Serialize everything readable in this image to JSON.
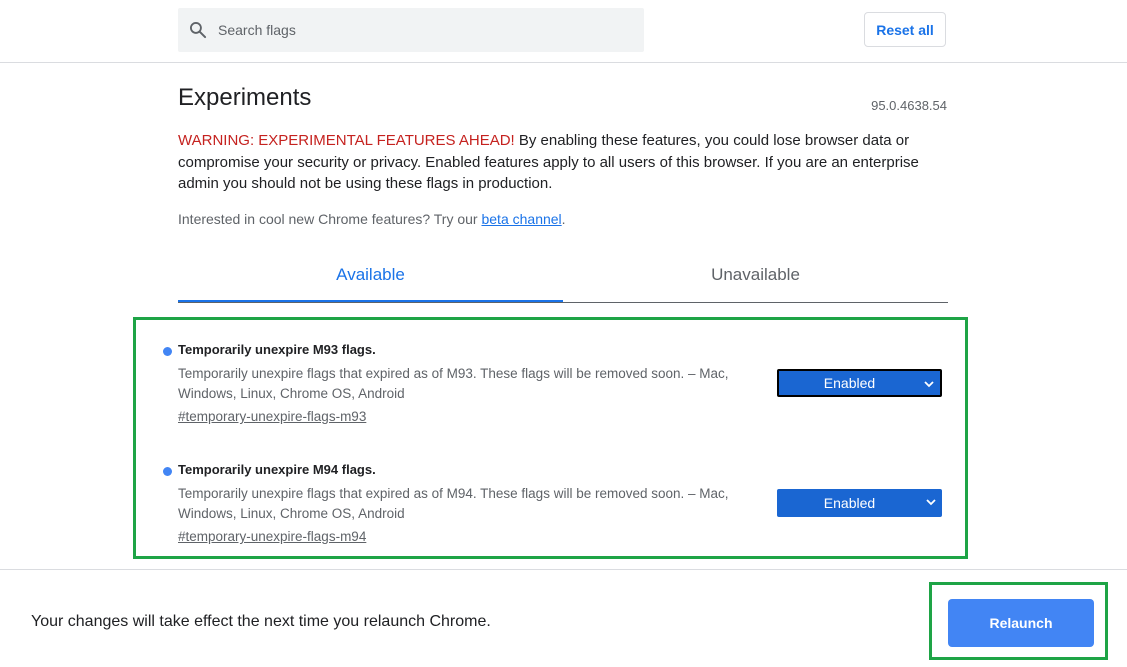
{
  "header": {
    "search_placeholder": "Search flags",
    "search_icon": "search-icon",
    "reset_label": "Reset all"
  },
  "main": {
    "title": "Experiments",
    "version": "95.0.4638.54",
    "warning_prefix": "WARNING: EXPERIMENTAL FEATURES AHEAD!",
    "warning_text": " By enabling these features, you could lose browser data or compromise your security or privacy. Enabled features apply to all users of this browser. If you are an enterprise admin you should not be using these flags in production.",
    "interest_text": "Interested in cool new Chrome features? Try our ",
    "interest_link": "beta channel",
    "interest_suffix": "."
  },
  "tabs": {
    "available": "Available",
    "unavailable": "Unavailable"
  },
  "flags": [
    {
      "title": "Temporarily unexpire M93 flags.",
      "description": "Temporarily unexpire flags that expired as of M93. These flags will be removed soon. – Mac, Windows, Linux, Chrome OS, Android",
      "link": "#temporary-unexpire-flags-m93",
      "value": "Enabled"
    },
    {
      "title": "Temporarily unexpire M94 flags.",
      "description": "Temporarily unexpire flags that expired as of M94. These flags will be removed soon. – Mac, Windows, Linux, Chrome OS, Android",
      "link": "#temporary-unexpire-flags-m94",
      "value": "Enabled"
    }
  ],
  "footer": {
    "message": "Your changes will take effect the next time you relaunch Chrome.",
    "relaunch_label": "Relaunch"
  },
  "colors": {
    "accent": "#1a73e8",
    "warning": "#c5221f",
    "highlight": "#1ea446",
    "relaunch_button": "#4285f4"
  }
}
